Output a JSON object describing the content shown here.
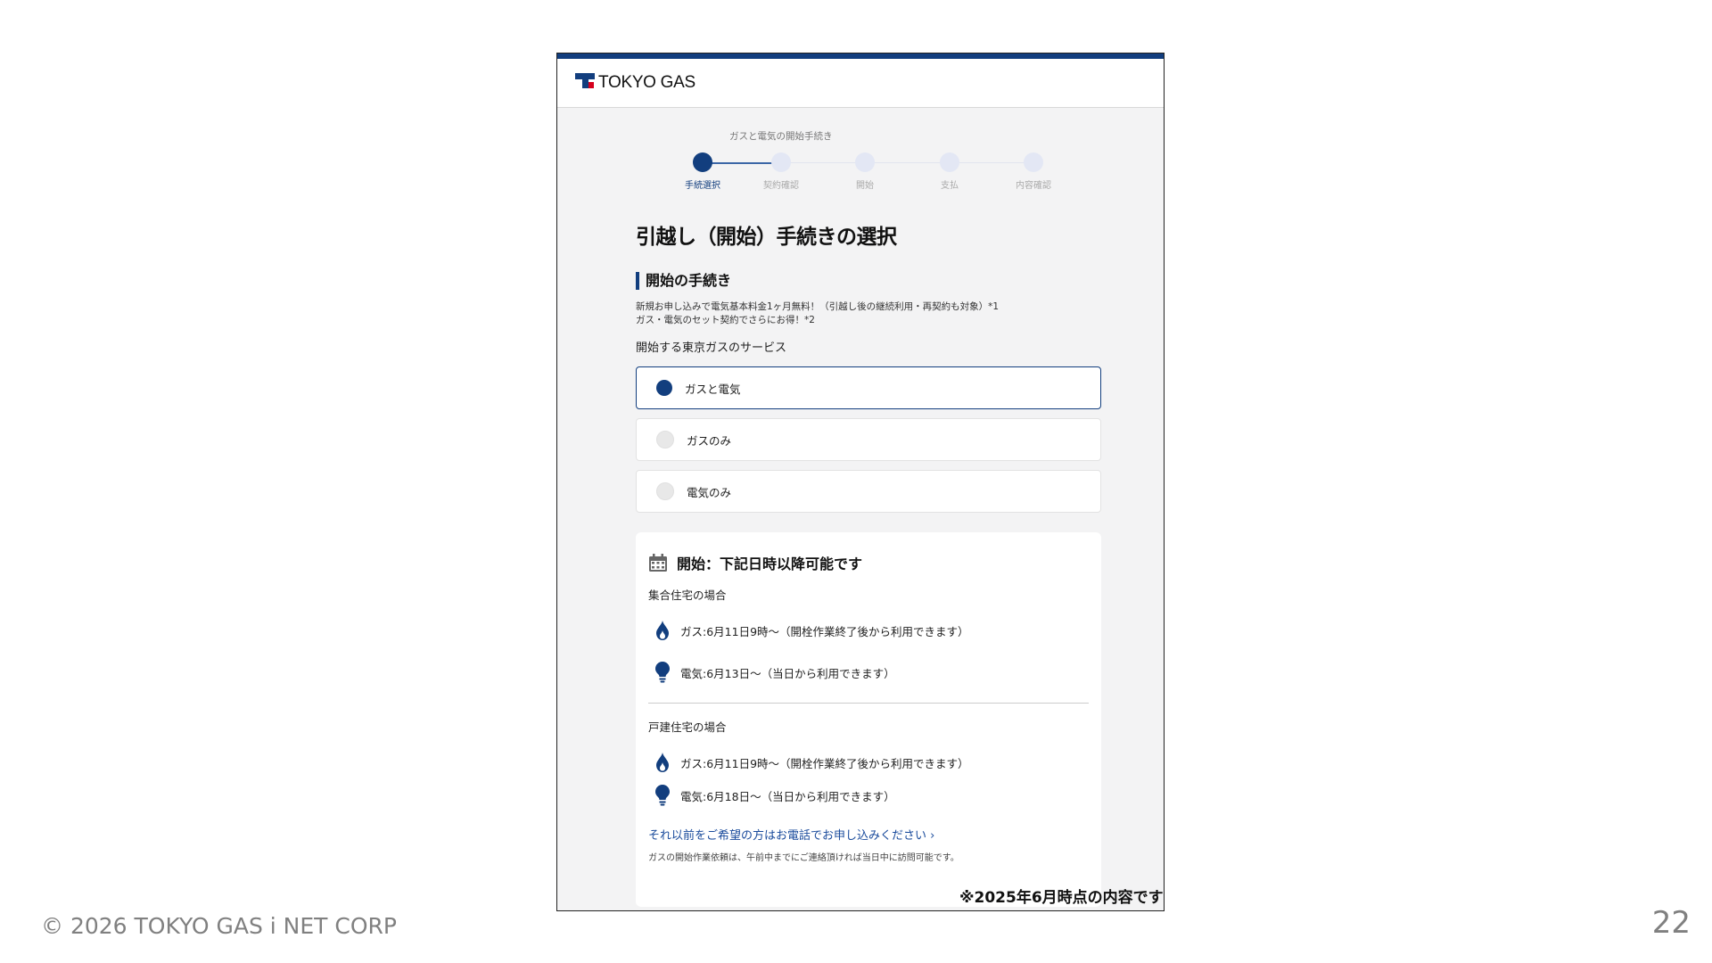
{
  "header": {
    "logo_text": "TOKYO GAS"
  },
  "progress": {
    "title": "ガスと電気の開始手続き",
    "steps": [
      {
        "label": "手続選択",
        "state": "active"
      },
      {
        "label": "契約確認",
        "state": "inactive"
      },
      {
        "label": "開始",
        "state": "inactive"
      },
      {
        "label": "支払",
        "state": "inactive"
      },
      {
        "label": "内容確認",
        "state": "inactive"
      }
    ]
  },
  "main": {
    "title": "引越し（開始）手続きの選択",
    "section_heading": "開始の手続き",
    "notice_line1": "新規お申し込みで電気基本料金1ヶ月無料！（引越し後の継続利用・再契約も対象）*1",
    "notice_line2": "ガス・電気のセット契約でさらにお得！*2",
    "service_label": "開始する東京ガスのサービス",
    "options": [
      {
        "label": "ガスと電気",
        "selected": true
      },
      {
        "label": "ガスのみ",
        "selected": false
      },
      {
        "label": "電気のみ",
        "selected": false
      }
    ]
  },
  "start_info": {
    "title": "開始：下記日時以降可能です",
    "apartment": {
      "heading": "集合住宅の場合",
      "gas": "ガス:6月11日9時〜（開栓作業終了後から利用できます）",
      "electricity": "電気:6月13日〜（当日から利用できます）"
    },
    "house": {
      "heading": "戸建住宅の場合",
      "gas": "ガス:6月11日9時〜（開栓作業終了後から利用できます）",
      "electricity": "電気:6月18日〜（当日から利用できます）"
    },
    "phone_link": "それ以前をご希望の方はお電話でお申し込みください ›",
    "small_note": "ガスの開始作業依頼は、午前中までにご連絡頂ければ当日中に訪問可能です。"
  },
  "slide": {
    "as_of_note": "※2025年6月時点の内容です",
    "copyright": "© 2026 TOKYO GAS i NET CORP",
    "page_number": "22"
  },
  "colors": {
    "brand_navy": "#123e7e",
    "brand_red": "#d6001c",
    "link_blue": "#1a4b9c"
  }
}
